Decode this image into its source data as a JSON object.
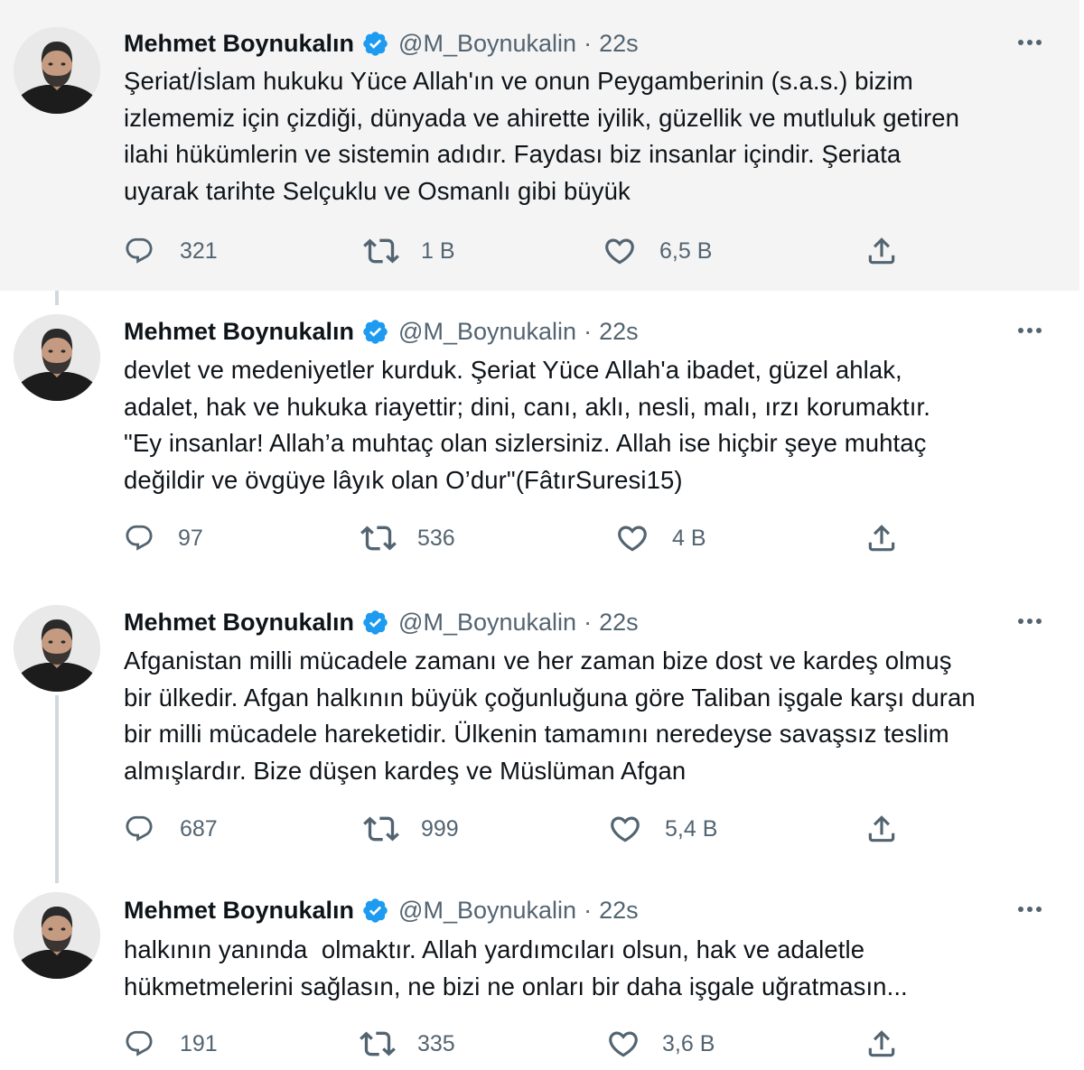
{
  "author": {
    "name": "Mehmet Boynukalın",
    "handle": "@M_Boynukalin",
    "separator": "·"
  },
  "colors": {
    "verified_badge": "#1d9bf0",
    "text_primary": "#0f1419",
    "text_secondary": "#536471",
    "thread_line": "#cfd9de",
    "highlight_background": "#f4f4f4"
  },
  "icons": {
    "reply": "reply-icon",
    "retweet": "retweet-icon",
    "like": "like-icon",
    "share": "share-icon",
    "more": "more-icon",
    "verified": "verified-badge-icon"
  },
  "tweets": [
    {
      "time": "22s",
      "text": "Şeriat/İslam hukuku Yüce Allah'ın ve onun Peygamberinin (s.a.s.) bizim\nizlememiz için çizdiği, dünyada ve ahirette iyilik, güzellik ve mutluluk getiren\nilahi hükümlerin ve sistemin adıdır. Faydası biz insanlar içindir. Şeriata\nuyarak tarihte Selçuklu ve Osmanlı gibi büyük",
      "replies": "321",
      "retweets": "1 B",
      "likes": "6,5 B"
    },
    {
      "time": "22s",
      "text": "devlet ve medeniyetler kurduk. Şeriat Yüce Allah'a ibadet, güzel ahlak,\nadalet, hak ve hukuka riayettir; dini, canı, aklı, nesli, malı, ırzı korumaktır.\n\"Ey insanlar! Allah’a muhtaç olan sizlersiniz. Allah ise hiçbir şeye muhtaç\ndeğildir ve övgüye lâyık olan O’dur\"(FâtırSuresi15)",
      "replies": "97",
      "retweets": "536",
      "likes": "4 B"
    },
    {
      "time": "22s",
      "text": "Afganistan milli mücadele zamanı ve her zaman bize dost ve kardeş olmuş\nbir ülkedir. Afgan halkının büyük çoğunluğuna göre Taliban işgale karşı duran\nbir milli mücadele hareketidir. Ülkenin tamamını neredeyse savaşsız teslim\nalmışlardır. Bize düşen kardeş ve Müslüman Afgan",
      "replies": "687",
      "retweets": "999",
      "likes": "5,4 B"
    },
    {
      "time": "22s",
      "text": "halkının yanında  olmaktır. Allah yardımcıları olsun, hak ve adaletle\nhükmetmelerini sağlasın, ne bizi ne onları bir daha işgale uğratmasın...",
      "replies": "191",
      "retweets": "335",
      "likes": "3,6 B"
    }
  ]
}
